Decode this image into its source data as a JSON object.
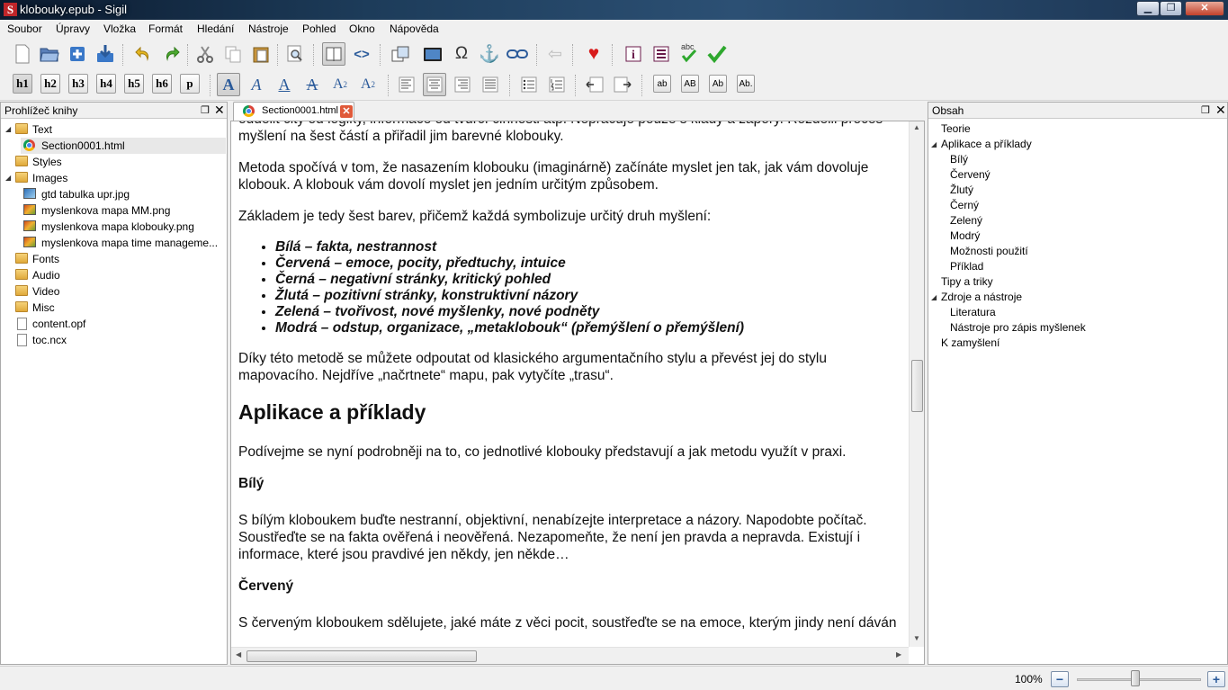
{
  "window": {
    "title": "klobouky.epub - Sigil",
    "app_icon_glyph": "S"
  },
  "menu": [
    "Soubor",
    "Úpravy",
    "Vložka",
    "Formát",
    "Hledání",
    "Nástroje",
    "Pohled",
    "Okno",
    "Nápověda"
  ],
  "toolbar2": {
    "headings": [
      "h1",
      "h2",
      "h3",
      "h4",
      "h5",
      "h6",
      "p"
    ],
    "case_buttons": [
      "ab",
      "AB",
      "Ab",
      "Ab."
    ],
    "spellcheck_label": "abc"
  },
  "book_browser": {
    "title": "Prohlížeč knihy",
    "items": [
      {
        "label": "Text",
        "type": "folder",
        "expanded": true
      },
      {
        "label": "Section0001.html",
        "type": "html",
        "selected": true
      },
      {
        "label": "Styles",
        "type": "folder"
      },
      {
        "label": "Images",
        "type": "folder",
        "expanded": true
      },
      {
        "label": "gtd tabulka upr.jpg",
        "type": "jpg"
      },
      {
        "label": "myslenkova mapa MM.png",
        "type": "png"
      },
      {
        "label": "myslenkova mapa klobouky.png",
        "type": "png"
      },
      {
        "label": "myslenkova mapa time manageme...",
        "type": "png"
      },
      {
        "label": "Fonts",
        "type": "folder"
      },
      {
        "label": "Audio",
        "type": "folder"
      },
      {
        "label": "Video",
        "type": "folder"
      },
      {
        "label": "Misc",
        "type": "folder"
      },
      {
        "label": "content.opf",
        "type": "file"
      },
      {
        "label": "toc.ncx",
        "type": "file"
      }
    ]
  },
  "editor": {
    "tab_label": "Section0001.html",
    "content": {
      "p0": "oddělit city od logiky, informace od tvůrčí činnosti atp. Nepracuje pouze s klady a zápory. Rozdělil proces myšlení na šest částí a přiřadil jim barevné klobouky.",
      "p1": "Metoda spočívá v tom, že nasazením klobouku (imaginárně) začínáte myslet jen tak, jak vám dovoluje klobouk. A klobouk vám dovolí myslet jen jedním určitým způsobem.",
      "p2": "Základem je tedy šest barev, přičemž každá symbolizuje určitý druh myšlení:",
      "list": [
        "Bílá – fakta, nestrannost",
        "Červená – emoce, pocity, předtuchy, intuice",
        "Černá – negativní stránky, kritický pohled",
        "Žlutá – pozitivní stránky, konstruktivní názory",
        "Zelená – tvořivost, nové myšlenky, nové podněty",
        "Modrá – odstup, organizace, „metaklobouk“ (přemýšlení o přemýšlení)"
      ],
      "p3": "Díky této metodě se můžete odpoutat od klasického argumentačního stylu a převést jej do stylu mapovacího. Nejdříve „načrtnete“ mapu, pak vytyčíte „trasu“.",
      "h1": "Aplikace a příklady",
      "p4": "Podívejme se nyní podrobněji na to, co jednotlivé klobouky představují a jak metodu využít v praxi.",
      "h3a": "Bílý",
      "p5": "S bílým kloboukem buďte nestranní, objektivní, nenabízejte interpretace a názory. Napodobte počítač. Soustřeďte se na fakta ověřená i neověřená. Nezapomeňte, že není jen pravda a nepravda. Existují i informace, které jsou pravdivé jen někdy, jen někde…",
      "h3b": "Červený",
      "p6": "S červeným kloboukem sdělujete, jaké máte z věci pocit, soustřeďte se na emoce, kterým jindy není dáván"
    }
  },
  "toc": {
    "title": "Obsah",
    "items": [
      {
        "label": "Teorie",
        "level": 0
      },
      {
        "label": "Aplikace a příklady",
        "level": 0,
        "expanded": true
      },
      {
        "label": "Bílý",
        "level": 1
      },
      {
        "label": "Červený",
        "level": 1
      },
      {
        "label": "Žlutý",
        "level": 1
      },
      {
        "label": "Černý",
        "level": 1
      },
      {
        "label": "Zelený",
        "level": 1
      },
      {
        "label": "Modrý",
        "level": 1
      },
      {
        "label": "Možnosti použití",
        "level": 1
      },
      {
        "label": "Příklad",
        "level": 1
      },
      {
        "label": "Tipy a triky",
        "level": 0
      },
      {
        "label": "Zdroje a nástroje",
        "level": 0,
        "expanded": true
      },
      {
        "label": "Literatura",
        "level": 1
      },
      {
        "label": "Nástroje pro zápis myšlenek",
        "level": 1
      },
      {
        "label": "K zamyšlení",
        "level": 0
      }
    ]
  },
  "status": {
    "zoom": "100%",
    "zoom_level": 0.47
  },
  "colors": {
    "accent_heart": "#d81b1b",
    "check_green": "#2ea82e",
    "close_red": "#e05a3a"
  }
}
